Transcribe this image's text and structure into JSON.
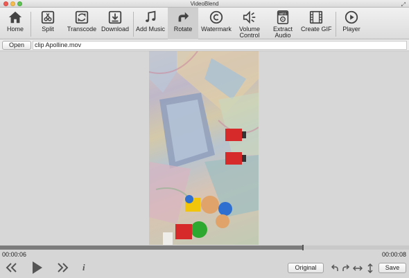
{
  "window": {
    "title": "VideoBlend"
  },
  "toolbar": {
    "items": [
      {
        "label": "Home",
        "icon": "home-icon"
      },
      {
        "label": "Split",
        "icon": "split-icon"
      },
      {
        "label": "Transcode",
        "icon": "transcode-icon"
      },
      {
        "label": "Download",
        "icon": "download-icon"
      },
      {
        "label": "Add Music",
        "icon": "music-note-icon"
      },
      {
        "label": "Rotate",
        "icon": "rotate-icon",
        "active": true
      },
      {
        "label": "Watermark",
        "icon": "watermark-icon"
      },
      {
        "label_line1": "Volume",
        "label_line2": "Control",
        "icon": "volume-icon"
      },
      {
        "label_line1": "Extract",
        "label_line2": "Audio",
        "icon": "extract-audio-icon",
        "badge": "MP3"
      },
      {
        "label": "Create GIF",
        "icon": "film-icon"
      },
      {
        "label": "Player",
        "icon": "play-circle-icon"
      }
    ]
  },
  "file": {
    "open_label": "Open",
    "filename": "clip Apolline.mov"
  },
  "timeline": {
    "current_time": "00:00:06",
    "total_time": "00:00:08",
    "progress": 0.74
  },
  "controls": {
    "original_label": "Original",
    "save_label": "Save",
    "info_glyph": "i"
  },
  "colors": {
    "accent": "#7c7c7c",
    "active_tool": "#cfcfcf"
  }
}
